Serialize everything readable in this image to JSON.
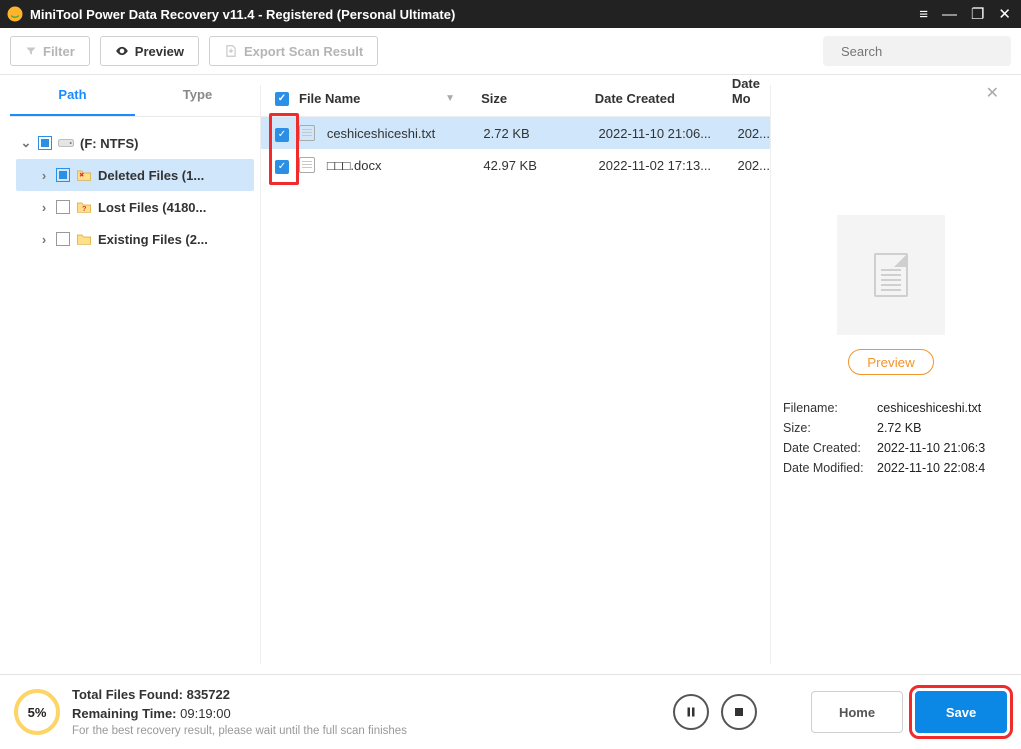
{
  "title": "MiniTool Power Data Recovery v11.4 - Registered (Personal Ultimate)",
  "toolbar": {
    "filter": "Filter",
    "preview": "Preview",
    "export": "Export Scan Result",
    "search_placeholder": "Search"
  },
  "tabs": {
    "path": "Path",
    "type": "Type"
  },
  "tree": {
    "drive": "(F: NTFS)",
    "deleted": "Deleted Files (1...",
    "lost": "Lost Files (4180...",
    "existing": "Existing Files (2..."
  },
  "columns": {
    "name": "File Name",
    "size": "Size",
    "created": "Date Created",
    "modified": "Date Mo"
  },
  "files": [
    {
      "name": "ceshiceshiceshi.txt",
      "size": "2.72 KB",
      "created": "2022-11-10 21:06...",
      "modified": "202..."
    },
    {
      "name": "□□□.docx",
      "size": "42.97 KB",
      "created": "2022-11-02 17:13...",
      "modified": "202..."
    }
  ],
  "preview": {
    "button": "Preview",
    "meta": [
      {
        "k": "Filename:",
        "v": "ceshiceshiceshi.txt"
      },
      {
        "k": "Size:",
        "v": "2.72 KB"
      },
      {
        "k": "Date Created:",
        "v": "2022-11-10 21:06:3"
      },
      {
        "k": "Date Modified:",
        "v": "2022-11-10 22:08:4"
      }
    ]
  },
  "footer": {
    "progress": "5%",
    "found_label": "Total Files Found:  ",
    "found_count": "835722",
    "remaining_label": "Remaining Time:  ",
    "remaining_value": "09:19:00",
    "hint": "For the best recovery result, please wait until the full scan finishes",
    "home": "Home",
    "save": "Save"
  }
}
